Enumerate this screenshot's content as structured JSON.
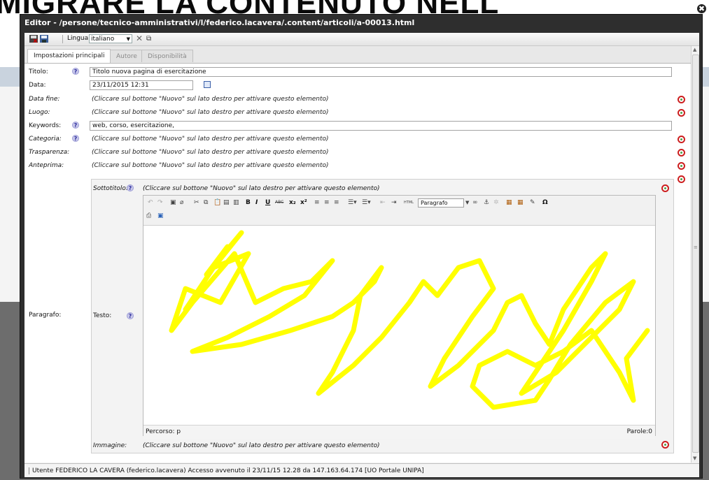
{
  "background": {
    "heading": "MIGRARE LA CONTENUTO NELL"
  },
  "window": {
    "title": "Editor - /persone/tecnico-amministrativi/l/federico.lacavera/.content/articoli/a-00013.html",
    "close_symbol": "✖"
  },
  "toolbar": {
    "language_label": "Lingua",
    "language_value": "italiano"
  },
  "tabs": [
    {
      "label": "Impostazioni principali",
      "active": true
    },
    {
      "label": "Autore",
      "active": false
    },
    {
      "label": "Disponibilità",
      "active": false
    }
  ],
  "fields": {
    "titolo": {
      "label": "Titolo:",
      "value": "Titolo nuova pagina di esercitazione"
    },
    "data": {
      "label": "Data:",
      "value": "23/11/2015 12:31"
    },
    "data_fine": {
      "label": "Data fine:",
      "hint": "(Cliccare sul bottone \"Nuovo\" sul lato destro per attivare questo elemento)"
    },
    "luogo": {
      "label": "Luogo:",
      "hint": "(Cliccare sul bottone \"Nuovo\" sul lato destro per attivare questo elemento)"
    },
    "keywords": {
      "label": "Keywords:",
      "value": "web, corso, esercitazione,"
    },
    "categoria": {
      "label": "Categoria:",
      "hint": "(Cliccare sul bottone \"Nuovo\" sul lato destro per attivare questo elemento)"
    },
    "trasparenza": {
      "label": "Trasparenza:",
      "hint": "(Cliccare sul bottone \"Nuovo\" sul lato destro per attivare questo elemento)"
    },
    "anteprima": {
      "label": "Anteprima:",
      "hint": "(Cliccare sul bottone \"Nuovo\" sul lato destro per attivare questo elemento)"
    }
  },
  "paragrafo": {
    "label": "Paragrafo:",
    "sottotitolo": {
      "label": "Sottotitolo:",
      "hint": "(Cliccare sul bottone \"Nuovo\" sul lato destro per attivare questo elemento)"
    },
    "testo": {
      "label": "Testo:"
    },
    "immagine": {
      "label": "Immagine:",
      "hint": "(Cliccare sul bottone \"Nuovo\" sul lato destro per attivare questo elemento)"
    }
  },
  "editor": {
    "format_value": "Paragrafo",
    "path_label": "Percorso: p",
    "words_label": "Parole:0",
    "buttons": {
      "bold": "B",
      "italic": "I",
      "underline": "U",
      "strike": "ABC",
      "subscript": "x₂",
      "superscript": "x²",
      "html": "HTML",
      "omega": "Ω"
    },
    "scribble_color": "#ffff00"
  },
  "footer": {
    "status": "Utente FEDERICO LA CAVERA (federico.lacavera) Accesso avvenuto il 23/11/15 12.28 da 147.163.64.174 [UO Portale UNIPA]"
  }
}
